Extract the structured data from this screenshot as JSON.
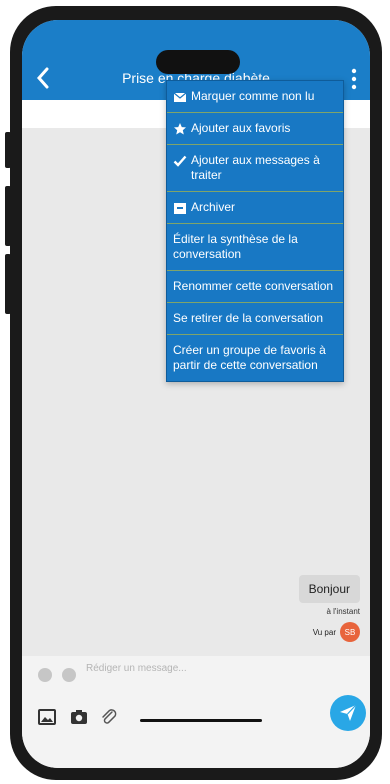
{
  "header": {
    "title": "Prise en charge diabète"
  },
  "menu": {
    "items": [
      {
        "label": "Marquer comme non lu",
        "icon": "envelope-icon"
      },
      {
        "label": "Ajouter aux favoris",
        "icon": "star-icon"
      },
      {
        "label": "Ajouter aux messages à traiter",
        "icon": "check-icon"
      },
      {
        "label": "Archiver",
        "icon": "archive-icon"
      },
      {
        "label": "Éditer la synthèse de la conversation"
      },
      {
        "label": "Renommer cette conversation"
      },
      {
        "label": "Se retirer de la conversation"
      },
      {
        "label": "Créer un groupe de favoris à partir de cette conversation"
      }
    ]
  },
  "chat": {
    "message": "Bonjour",
    "time": "à l'instant",
    "seen_label": "Vu par",
    "avatar_initials": "SB"
  },
  "composer": {
    "placeholder": "Rédiger un message..."
  },
  "colors": {
    "accent": "#1b7ec8",
    "menu": "#1878c4",
    "send": "#29a7e6",
    "avatar": "#e8643c"
  }
}
